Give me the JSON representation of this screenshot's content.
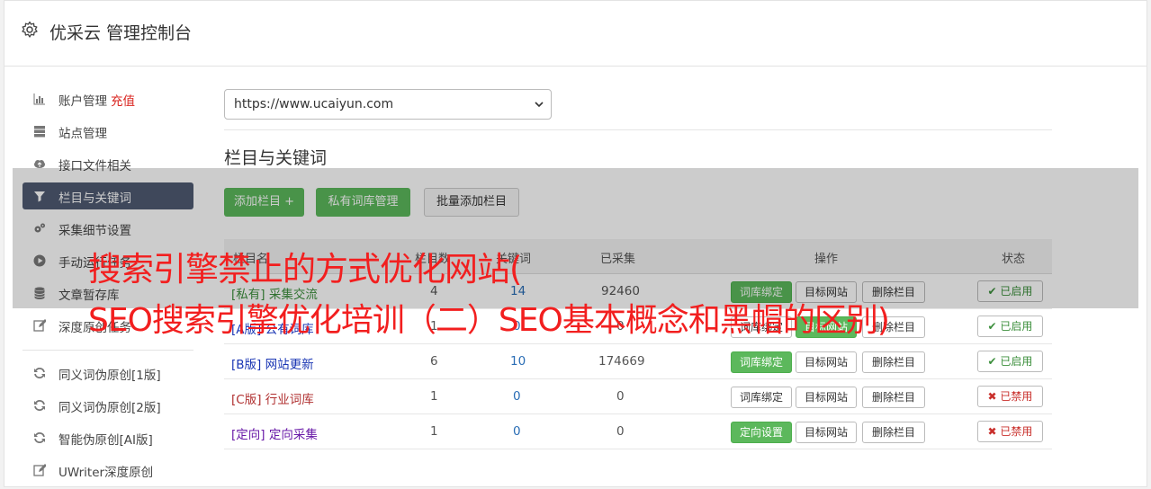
{
  "header": {
    "title": "优采云 管理控制台",
    "icon": "gear-icon"
  },
  "sidebar": {
    "items": [
      {
        "label": "账户管理",
        "extra": "充值",
        "icon": "bar-chart-icon"
      },
      {
        "label": "站点管理",
        "icon": "server-icon"
      },
      {
        "label": "接口文件相关",
        "icon": "cloud-upload-icon"
      },
      {
        "label": "栏目与关键词",
        "icon": "filter-icon",
        "active": true
      },
      {
        "label": "采集细节设置",
        "icon": "cogs-icon"
      },
      {
        "label": "手动运行任务",
        "icon": "play-circle-icon"
      },
      {
        "label": "文章暂存库",
        "icon": "database-icon"
      },
      {
        "label": "深度原创任务",
        "icon": "edit-icon"
      },
      {
        "label": "同义词伪原创[1版]",
        "icon": "refresh-icon"
      },
      {
        "label": "同义词伪原创[2版]",
        "icon": "refresh-icon"
      },
      {
        "label": "智能伪原创[AI版]",
        "icon": "refresh-icon"
      },
      {
        "label": "UWriter深度原创",
        "icon": "edit-icon"
      }
    ]
  },
  "site_select": {
    "value": "https://www.ucaiyun.com"
  },
  "section": {
    "title": "栏目与关键词"
  },
  "toolbar": {
    "add_column": "添加栏目 +",
    "private_lib": "私有词库管理",
    "batch_add": "批量添加栏目"
  },
  "table": {
    "headers": {
      "name": "栏目名",
      "c1": "栏目数",
      "c2": "关键词",
      "collected": "已采集",
      "ops": "操作",
      "status": "状态"
    },
    "rows": [
      {
        "tag": "[私有]",
        "name": "采集交流",
        "a": "4",
        "b": "14",
        "c": "92460",
        "bind_label": "词库绑定",
        "target": "目标网站",
        "delete": "删除栏目",
        "status": "已启用"
      },
      {
        "tag": "[A版]",
        "name": "公有词库",
        "a": "1",
        "b": "0",
        "c": "0",
        "bind_label": "词库绑定",
        "target": "目标网站",
        "delete": "删除栏目",
        "status": "已启用"
      },
      {
        "tag": "[B版]",
        "name": "网站更新",
        "a": "6",
        "b": "10",
        "c": "174669",
        "bind_label": "词库绑定",
        "target": "目标网站",
        "delete": "删除栏目",
        "status": "已启用"
      },
      {
        "tag": "[C版]",
        "name": "行业词库",
        "a": "1",
        "b": "0",
        "c": "0",
        "bind_label": "词库绑定",
        "target": "目标网站",
        "delete": "删除栏目",
        "status": "已禁用"
      },
      {
        "tag": "[定向]",
        "name": "定向采集",
        "a": "1",
        "b": "0",
        "c": "0",
        "bind_label": "定向设置",
        "target": "目标网站",
        "delete": "删除栏目",
        "status": "已禁用"
      }
    ]
  },
  "overlay": {
    "line1": "搜索引擎禁止的方式优化网站(",
    "line2": "SEO搜索引擎优化培训（二）SEO基本概念和黑帽的区别)"
  },
  "colors": {
    "accent_green": "#5cb85c",
    "sidebar_active": "#4f5b72",
    "overlay_text": "#f21f1f"
  }
}
